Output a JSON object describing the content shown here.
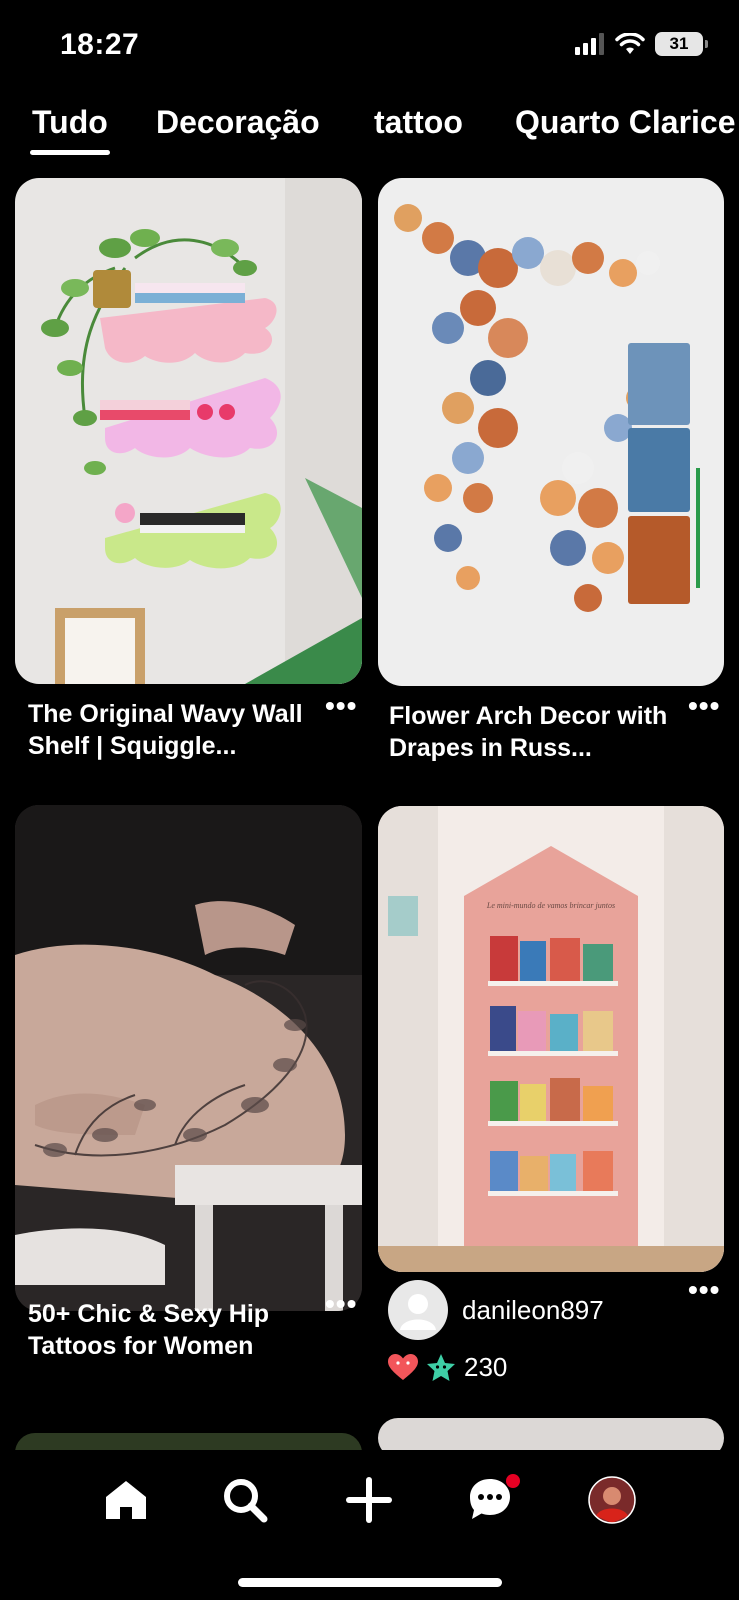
{
  "status_bar": {
    "time": "18:27",
    "battery": "31"
  },
  "tabs": [
    {
      "label": "Tudo",
      "active": true
    },
    {
      "label": "Decoração",
      "active": false
    },
    {
      "label": "tattoo",
      "active": false
    },
    {
      "label": "Quarto Clarice",
      "active": false
    }
  ],
  "pins": [
    {
      "title": "The Original Wavy Wall Shelf | Squiggle...",
      "more": "•••"
    },
    {
      "title": "Flower Arch Decor with Drapes in Russ...",
      "more": "•••"
    },
    {
      "title": "50+ Chic & Sexy Hip Tattoos for Women",
      "more": "•••"
    },
    {
      "creator": "danileon897",
      "reaction_count": "230",
      "more": "•••"
    }
  ],
  "book_wall_text": "Le mini-mundo de vamos brincar juntos",
  "colors": {
    "background": "#000000",
    "notification_dot": "#e60023"
  },
  "nav": {
    "items": [
      "home-icon",
      "search-icon",
      "plus-icon",
      "messages-icon",
      "profile-avatar"
    ],
    "active": "home-icon"
  }
}
